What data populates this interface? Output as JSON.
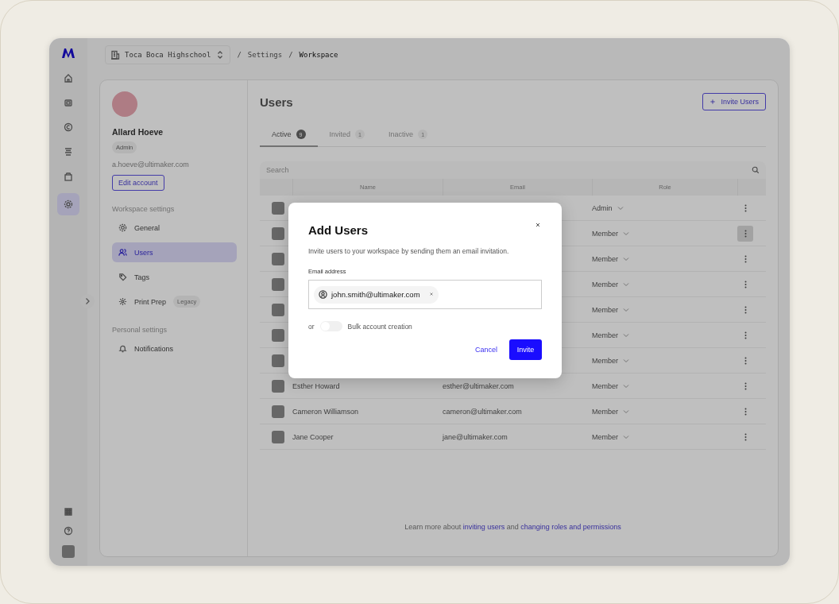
{
  "breadcrumb": [
    {
      "kind": "switcher",
      "text": "Toca Boca Highschool"
    },
    {
      "kind": "separator",
      "text": "/"
    },
    {
      "kind": "link",
      "text": "Settings"
    },
    {
      "kind": "separator",
      "text": "/"
    },
    {
      "kind": "current",
      "text": "Workspace"
    }
  ],
  "rail": {
    "top": [
      {
        "kind": "home",
        "selected": false
      },
      {
        "kind": "printer",
        "selected": false
      },
      {
        "kind": "material",
        "selected": false
      },
      {
        "kind": "queue",
        "selected": false
      },
      {
        "kind": "box",
        "selected": false
      },
      {
        "kind": "settings",
        "selected": true
      }
    ],
    "bottom": [
      {
        "kind": "apps"
      },
      {
        "kind": "help"
      },
      {
        "kind": "avatar"
      }
    ]
  },
  "profile": {
    "name": "Allard Hoeve",
    "role": "Admin",
    "email": "a.hoeve@ultimaker.com",
    "edit_button": "Edit account"
  },
  "settings_nav": [
    {
      "title": "Workspace settings",
      "items": [
        {
          "label": "General",
          "selected": false
        },
        {
          "label": "Users",
          "selected": true
        },
        {
          "label": "Tags",
          "selected": false
        },
        {
          "label": "Print Prep",
          "badge": "Legacy",
          "selected": false
        }
      ]
    },
    {
      "title": "Personal settings",
      "items": [
        {
          "label": "Notifications",
          "selected": false
        }
      ]
    }
  ],
  "users": {
    "title": "Users",
    "invite_button": "Invite Users",
    "tabs": [
      {
        "label": "Active",
        "count": "9",
        "selected": true
      },
      {
        "label": "Invited",
        "count": "1",
        "selected": false
      },
      {
        "label": "Inactive",
        "count": "1",
        "selected": false
      }
    ],
    "search": {
      "placeholder": "Search"
    },
    "columns": [
      "Name",
      "Email",
      "Role"
    ],
    "rows": [
      {
        "role": "Admin",
        "highlighted": false
      },
      {
        "role": "Member",
        "highlighted": true
      },
      {
        "role": "Member",
        "highlighted": false
      },
      {
        "role": "Member",
        "highlighted": false
      },
      {
        "role": "Member",
        "highlighted": false
      },
      {
        "role": "Member",
        "highlighted": false
      },
      {
        "role": "Member",
        "highlighted": false
      },
      {
        "name": "Esther Howard",
        "email": "esther@ultimaker.com",
        "role": "Member",
        "highlighted": false
      },
      {
        "name": "Cameron Williamson",
        "email": "cameron@ultimaker.com",
        "role": "Member",
        "highlighted": false
      },
      {
        "name": "Jane Cooper",
        "email": "jane@ultimaker.com",
        "role": "Member",
        "highlighted": false
      }
    ],
    "help": [
      {
        "kind": "text",
        "text": "Learn more about"
      },
      {
        "kind": "link",
        "text": "inviting users"
      },
      {
        "kind": "text",
        "text": "and"
      },
      {
        "kind": "link",
        "text": "changing roles and permissions"
      }
    ]
  },
  "modal": {
    "title": "Add Users",
    "description": "Invite users to your workspace by sending them an email invitation.",
    "field_label": "Email address",
    "chips": [
      {
        "text": "john.smith@ultimaker.com"
      }
    ],
    "toggle": {
      "prefix": "or",
      "label": "Bulk account creation",
      "on": false
    },
    "cancel": "Cancel",
    "confirm": "Invite"
  }
}
